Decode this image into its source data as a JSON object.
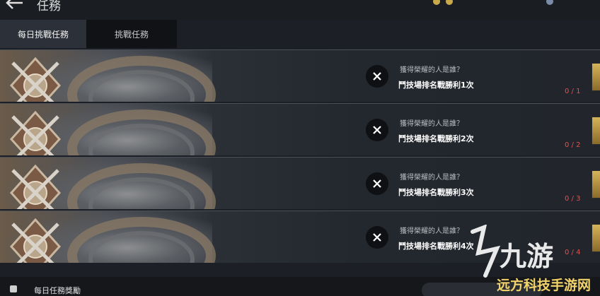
{
  "header": {
    "title": "任務",
    "currency_1": "",
    "currency_2": ""
  },
  "tabs": [
    {
      "label": "每日挑戰任務"
    },
    {
      "label": "挑戰任務"
    }
  ],
  "tasks": [
    {
      "question": "獲得榮耀的人是誰？",
      "goal": "鬥技場排名戰勝利1次",
      "progress": "0 / 1"
    },
    {
      "question": "獲得榮耀的人是誰？",
      "goal": "鬥技場排名戰勝利2次",
      "progress": "0 / 2"
    },
    {
      "question": "獲得榮耀的人是誰？",
      "goal": "鬥技場排名戰勝利3次",
      "progress": "0 / 3"
    },
    {
      "question": "獲得榮耀的人是誰？",
      "goal": "鬥技場排名戰勝利4次",
      "progress": "0 / 4"
    }
  ],
  "footer": {
    "label": "每日任務獎勵"
  },
  "watermark": {
    "text": "九游",
    "subtext": "远方科技手游网"
  },
  "colors": {
    "progress": "#d9534f",
    "reward_gold": "#d6b45a",
    "watermark": "#ffffff"
  }
}
